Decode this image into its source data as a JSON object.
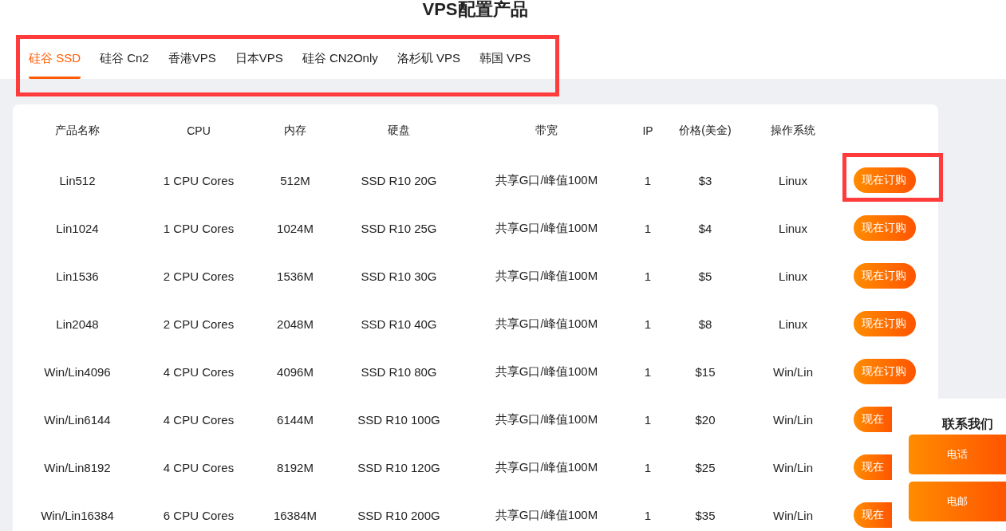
{
  "title": "VPS配置产品",
  "tabs": [
    {
      "label": "硅谷 SSD",
      "selected": true
    },
    {
      "label": "硅谷 Cn2",
      "selected": false
    },
    {
      "label": "香港VPS",
      "selected": false
    },
    {
      "label": "日本VPS",
      "selected": false
    },
    {
      "label": "硅谷 CN2Only",
      "selected": false
    },
    {
      "label": "洛杉矶 VPS",
      "selected": false
    },
    {
      "label": "韩国 VPS",
      "selected": false
    }
  ],
  "table": {
    "columns": [
      "产品名称",
      "CPU",
      "内存",
      "硬盘",
      "带宽",
      "IP",
      "价格(美金)",
      "操作系统"
    ],
    "rows": [
      {
        "cells": [
          "Lin512",
          "1 CPU Cores",
          "512M",
          "SSD R10 20G",
          "共享G口/峰值100M",
          "1",
          "$3",
          "Linux"
        ],
        "action": "现在订购",
        "highlighted": true
      },
      {
        "cells": [
          "Lin1024",
          "1 CPU Cores",
          "1024M",
          "SSD R10 25G",
          "共享G口/峰值100M",
          "1",
          "$4",
          "Linux"
        ],
        "action": "现在订购",
        "highlighted": false
      },
      {
        "cells": [
          "Lin1536",
          "2 CPU Cores",
          "1536M",
          "SSD R10 30G",
          "共享G口/峰值100M",
          "1",
          "$5",
          "Linux"
        ],
        "action": "现在订购",
        "highlighted": false
      },
      {
        "cells": [
          "Lin2048",
          "2 CPU Cores",
          "2048M",
          "SSD R10 40G",
          "共享G口/峰值100M",
          "1",
          "$8",
          "Linux"
        ],
        "action": "现在订购",
        "highlighted": false
      },
      {
        "cells": [
          "Win/Lin4096",
          "4 CPU Cores",
          "4096M",
          "SSD R10 80G",
          "共享G口/峰值100M",
          "1",
          "$15",
          "Win/Lin"
        ],
        "action": "现在订购",
        "highlighted": false
      },
      {
        "cells": [
          "Win/Lin6144",
          "4 CPU Cores",
          "6144M",
          "SSD R10 100G",
          "共享G口/峰值100M",
          "1",
          "$20",
          "Win/Lin"
        ],
        "action": "现在",
        "highlighted": false,
        "partly_hidden": true
      },
      {
        "cells": [
          "Win/Lin8192",
          "4 CPU Cores",
          "8192M",
          "SSD R10 120G",
          "共享G口/峰值100M",
          "1",
          "$25",
          "Win/Lin"
        ],
        "action": "现在",
        "highlighted": false,
        "partly_hidden": true
      },
      {
        "cells": [
          "Win/Lin16384",
          "6 CPU Cores",
          "16384M",
          "SSD R10 200G",
          "共享G口/峰值100M",
          "1",
          "$35",
          "Win/Lin"
        ],
        "action": "现在",
        "highlighted": false,
        "partly_hidden": true
      }
    ]
  },
  "tabs_highlighted": true,
  "contact": {
    "title": "联系我们",
    "buttons": [
      "电话",
      "电邮"
    ]
  }
}
